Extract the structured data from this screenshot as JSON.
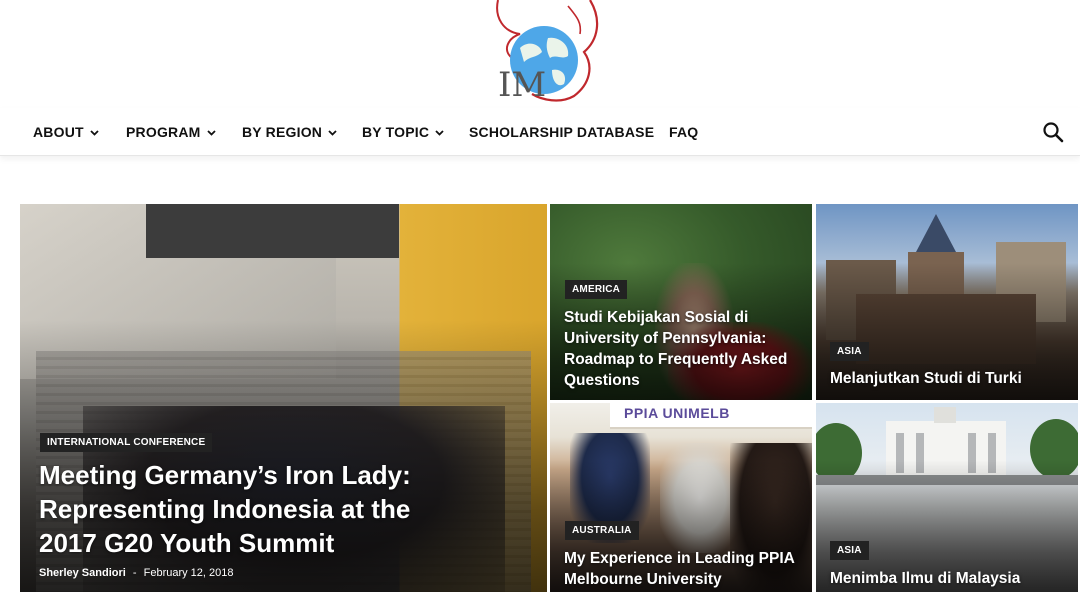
{
  "logo": {
    "text": "IM"
  },
  "nav": {
    "items": [
      {
        "label": "ABOUT",
        "dropdown": true
      },
      {
        "label": "PROGRAM",
        "dropdown": true
      },
      {
        "label": "BY REGION",
        "dropdown": true
      },
      {
        "label": "BY TOPIC",
        "dropdown": true
      },
      {
        "label": "SCHOLARSHIP DATABASE",
        "dropdown": false
      },
      {
        "label": "FAQ",
        "dropdown": false
      }
    ],
    "search_icon": "search-icon"
  },
  "featured": {
    "main": {
      "category": "INTERNATIONAL CONFERENCE",
      "title": "Meeting Germany’s Iron Lady: Representing Indonesia at the 2017 G20 Youth Summit",
      "author": "Sherley Sandiori",
      "separator": "-",
      "date": "February 12, 2018"
    },
    "tiles": [
      {
        "category": "AMERICA",
        "title": "Studi Kebijakan Sosial di University of Pennsylvania: Roadmap to Frequently Asked Questions"
      },
      {
        "category": "ASIA",
        "title": "Melanjutkan Studi di Turki"
      },
      {
        "category": "AUSTRALIA",
        "title": "My Experience in Leading PPIA Melbourne University",
        "sign_text": "PPIA UNIMELB"
      },
      {
        "category": "ASIA",
        "title": "Menimba Ilmu di Malaysia"
      }
    ]
  },
  "colors": {
    "accent": "#c0282d",
    "globe": "#2f8fd6",
    "badge": "#222222"
  }
}
